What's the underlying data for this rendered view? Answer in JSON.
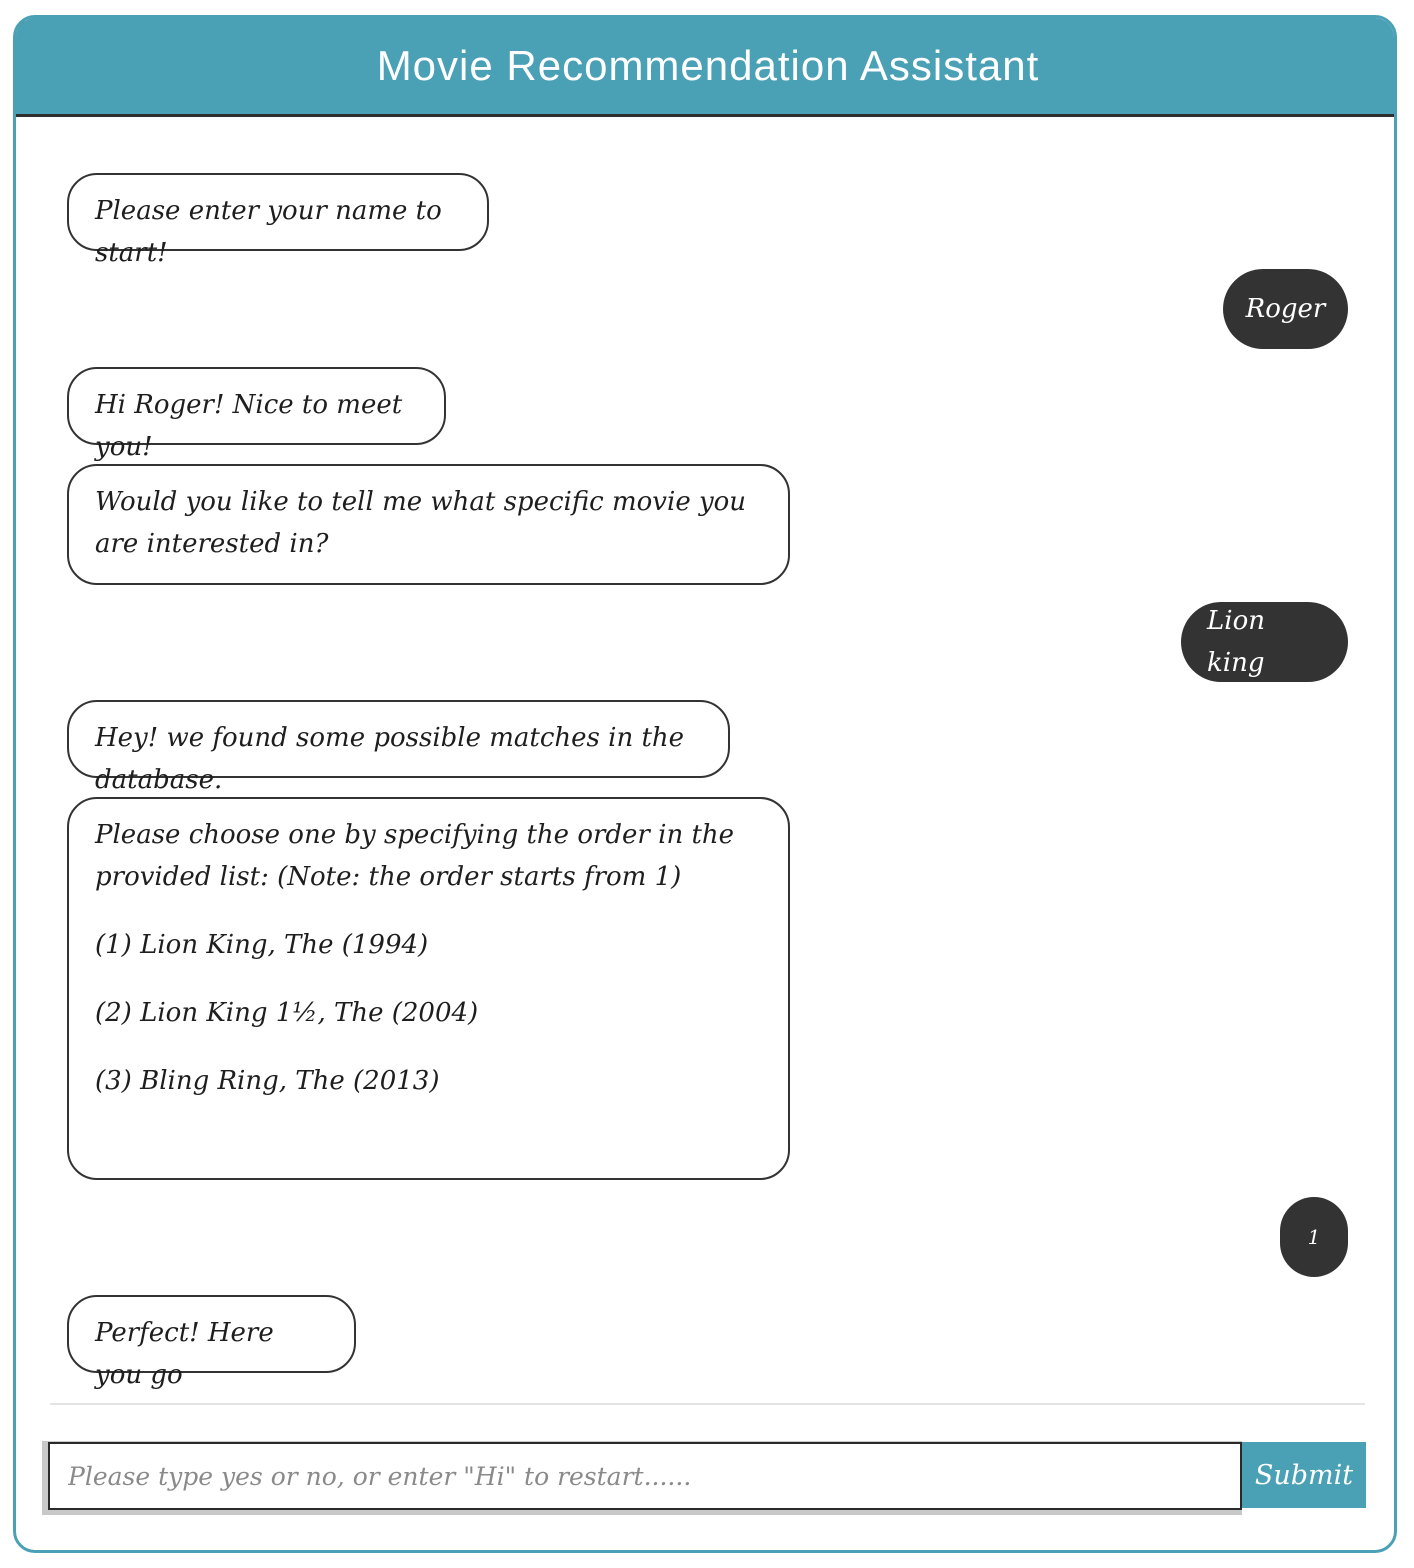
{
  "header": {
    "title": "Movie Recommendation Assistant"
  },
  "messages": [
    {
      "sender": "bot",
      "text": "Please enter your name to start!"
    },
    {
      "sender": "user",
      "text": "Roger"
    },
    {
      "sender": "bot",
      "text": "Hi Roger! Nice to meet you!"
    },
    {
      "sender": "bot",
      "text": "Would you like to tell me what specific movie you are interested in?"
    },
    {
      "sender": "user",
      "text": "Lion king"
    },
    {
      "sender": "bot",
      "text": "Hey! we found some possible matches in the database."
    },
    {
      "sender": "bot",
      "text": "Please choose one by specifying the order in the provided list: (Note: the order starts from 1)",
      "options": [
        "(1) Lion King, The (1994)",
        "(2) Lion King 1½, The (2004)",
        "(3) Bling Ring, The (2013)"
      ]
    },
    {
      "sender": "user",
      "text": "1"
    },
    {
      "sender": "bot",
      "text": "Perfect! Here you go"
    }
  ],
  "composer": {
    "placeholder": "Please type yes or no, or enter \"Hi\" to restart......",
    "submit_label": "Submit"
  },
  "colors": {
    "accent": "#4aa0b5",
    "user_bubble": "#333333",
    "bot_border": "#333333"
  }
}
